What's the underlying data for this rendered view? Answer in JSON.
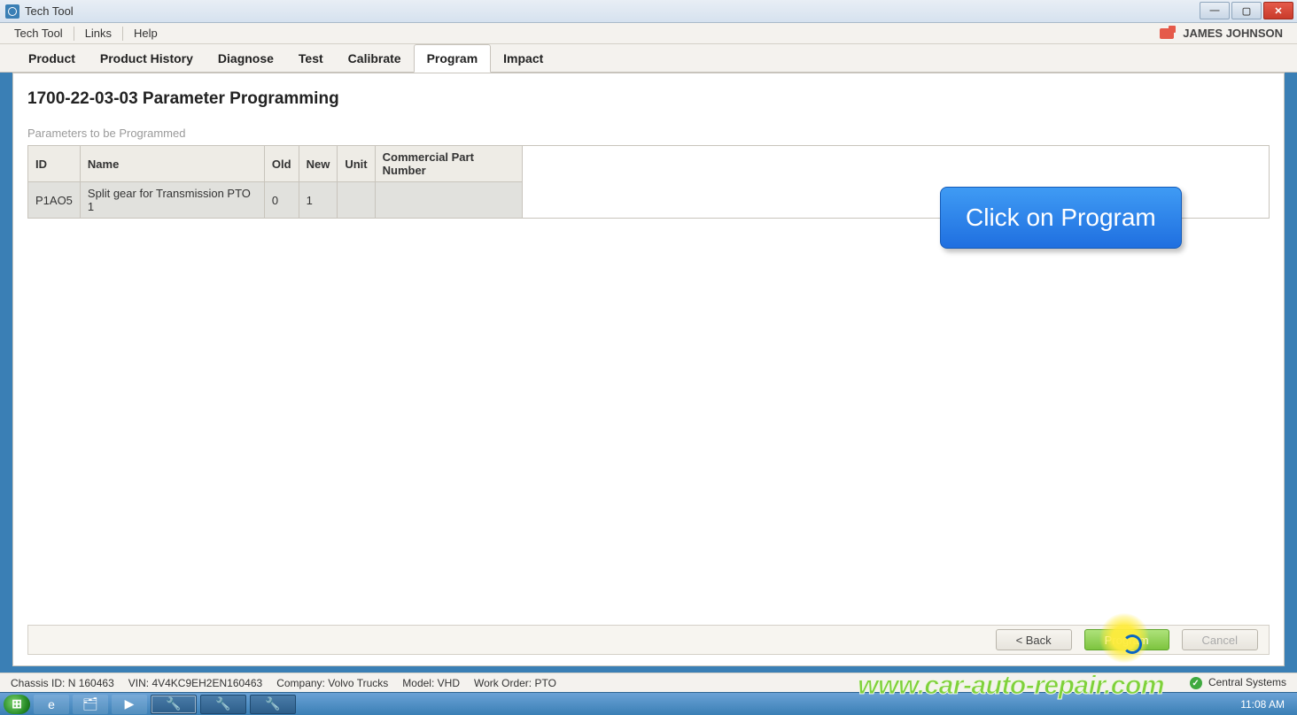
{
  "window": {
    "title": "Tech Tool"
  },
  "menubar": {
    "items": [
      "Tech Tool",
      "Links",
      "Help"
    ],
    "user": "JAMES JOHNSON"
  },
  "tabs": {
    "items": [
      "Product",
      "Product History",
      "Diagnose",
      "Test",
      "Calibrate",
      "Program",
      "Impact"
    ],
    "active": "Program"
  },
  "page": {
    "title": "1700-22-03-03 Parameter Programming",
    "subheading": "Parameters to be Programmed"
  },
  "table": {
    "headers": {
      "id": "ID",
      "name": "Name",
      "old": "Old",
      "new": "New",
      "unit": "Unit",
      "cpn": "Commercial Part Number"
    },
    "rows": [
      {
        "id": "P1AO5",
        "name": "Split gear for Transmission PTO 1",
        "old": "0",
        "new": "1",
        "unit": "",
        "cpn": ""
      }
    ]
  },
  "callout": {
    "text": "Click on Program"
  },
  "footer": {
    "back": "< Back",
    "program": "Program",
    "cancel": "Cancel"
  },
  "status": {
    "chassis_label": "Chassis ID:",
    "chassis": "N 160463",
    "vin_label": "VIN:",
    "vin": "4V4KC9EH2EN160463",
    "company_label": "Company:",
    "company": "Volvo Trucks",
    "model_label": "Model:",
    "model": "VHD",
    "workorder_label": "Work Order:",
    "workorder": "PTO",
    "connection": "Central Systems"
  },
  "taskbar": {
    "clock": "11:08 AM"
  },
  "watermark": "www.car-auto-repair.com"
}
